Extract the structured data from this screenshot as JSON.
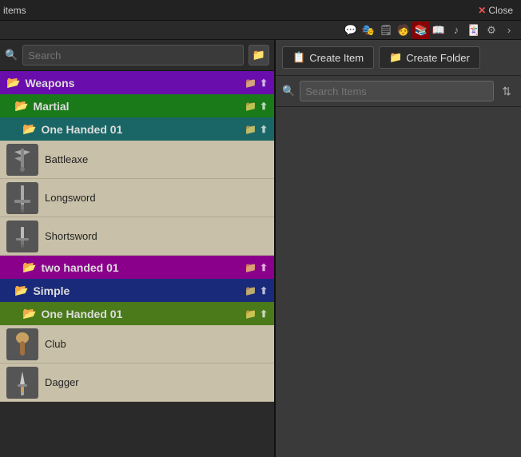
{
  "topbar": {
    "title": "items",
    "close_label": "Close"
  },
  "icons": [
    {
      "name": "chat-icon",
      "symbol": "💬"
    },
    {
      "name": "people-icon",
      "symbol": "👥"
    },
    {
      "name": "map-icon",
      "symbol": "🗺"
    },
    {
      "name": "actors-icon",
      "symbol": "👤"
    },
    {
      "name": "book-icon",
      "symbol": "📖"
    },
    {
      "name": "items-icon",
      "symbol": "🎒"
    },
    {
      "name": "music-icon",
      "symbol": "♪"
    },
    {
      "name": "note-icon",
      "symbol": "📝"
    },
    {
      "name": "settings-icon",
      "symbol": "⚙"
    },
    {
      "name": "chevron-icon",
      "symbol": "›"
    }
  ],
  "left": {
    "search_placeholder": "Search",
    "categories": [
      {
        "id": "weapons",
        "label": "Weapons",
        "color_class": "cat-weapons",
        "children": [
          {
            "id": "martial",
            "label": "Martial",
            "color_class": "cat-martial",
            "children": [
              {
                "id": "one-handed-1",
                "label": "One Handed 01",
                "color_class": "cat-one-handed-1",
                "items": [
                  {
                    "name": "Battleaxe",
                    "icon_type": "axe"
                  },
                  {
                    "name": "Longsword",
                    "icon_type": "sword"
                  },
                  {
                    "name": "Shortsword",
                    "icon_type": "short-sword"
                  }
                ]
              },
              {
                "id": "two-handed",
                "label": "two handed 01",
                "color_class": "cat-two-handed",
                "items": []
              }
            ]
          },
          {
            "id": "simple",
            "label": "Simple",
            "color_class": "cat-simple",
            "children": [
              {
                "id": "one-handed-2",
                "label": "One Handed 01",
                "color_class": "cat-one-handed-2",
                "items": [
                  {
                    "name": "Club",
                    "icon_type": "club"
                  },
                  {
                    "name": "Dagger",
                    "icon_type": "dagger"
                  }
                ]
              }
            ]
          }
        ]
      }
    ]
  },
  "right": {
    "create_item_label": "Create Item",
    "create_folder_label": "Create Folder",
    "search_placeholder": "Search Items"
  }
}
